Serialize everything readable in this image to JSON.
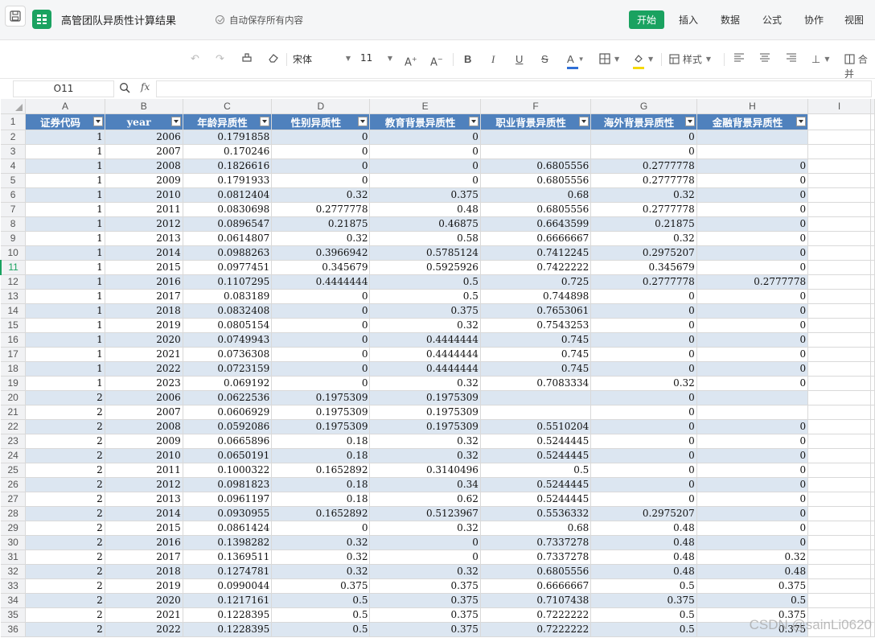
{
  "app": {
    "doc_title": "高管团队异质性计算结果",
    "autosave_text": "自动保存所有内容",
    "menus": [
      "开始",
      "插入",
      "数据",
      "公式",
      "协作",
      "视图"
    ],
    "active_menu": "开始"
  },
  "toolbar": {
    "font_name": "宋体",
    "font_size": "11",
    "style_label": "样式",
    "merge_label": "合并",
    "font_color": "#2f6fd6",
    "fill_color": "#f5d90a"
  },
  "formula_bar": {
    "cell_ref": "O11",
    "fx_label": "fx",
    "formula": ""
  },
  "sheet": {
    "columns": [
      "A",
      "B",
      "C",
      "D",
      "E",
      "F",
      "G",
      "H",
      "I"
    ],
    "headers": [
      "证券代码",
      "year",
      "年龄异质性",
      "性别异质性",
      "教育背景异质性",
      "职业背景异质性",
      "海外背景异质性",
      "金融背景异质性"
    ],
    "header_color": "#4f81bd",
    "band_color": "#dce6f1",
    "active_row": 11,
    "rows": [
      [
        "1",
        "2006",
        "0.1791858",
        "0",
        "0",
        "",
        "0",
        ""
      ],
      [
        "1",
        "2007",
        "0.170246",
        "0",
        "0",
        "",
        "0",
        ""
      ],
      [
        "1",
        "2008",
        "0.1826616",
        "0",
        "0",
        "0.6805556",
        "0.2777778",
        "0"
      ],
      [
        "1",
        "2009",
        "0.1791933",
        "0",
        "0",
        "0.6805556",
        "0.2777778",
        "0"
      ],
      [
        "1",
        "2010",
        "0.0812404",
        "0.32",
        "0.375",
        "0.68",
        "0.32",
        "0"
      ],
      [
        "1",
        "2011",
        "0.0830698",
        "0.2777778",
        "0.48",
        "0.6805556",
        "0.2777778",
        "0"
      ],
      [
        "1",
        "2012",
        "0.0896547",
        "0.21875",
        "0.46875",
        "0.6643599",
        "0.21875",
        "0"
      ],
      [
        "1",
        "2013",
        "0.0614807",
        "0.32",
        "0.58",
        "0.6666667",
        "0.32",
        "0"
      ],
      [
        "1",
        "2014",
        "0.0988263",
        "0.3966942",
        "0.5785124",
        "0.7412245",
        "0.2975207",
        "0"
      ],
      [
        "1",
        "2015",
        "0.0977451",
        "0.345679",
        "0.5925926",
        "0.7422222",
        "0.345679",
        "0"
      ],
      [
        "1",
        "2016",
        "0.1107295",
        "0.4444444",
        "0.5",
        "0.725",
        "0.2777778",
        "0.2777778"
      ],
      [
        "1",
        "2017",
        "0.083189",
        "0",
        "0.5",
        "0.744898",
        "0",
        "0"
      ],
      [
        "1",
        "2018",
        "0.0832408",
        "0",
        "0.375",
        "0.7653061",
        "0",
        "0"
      ],
      [
        "1",
        "2019",
        "0.0805154",
        "0",
        "0.32",
        "0.7543253",
        "0",
        "0"
      ],
      [
        "1",
        "2020",
        "0.0749943",
        "0",
        "0.4444444",
        "0.745",
        "0",
        "0"
      ],
      [
        "1",
        "2021",
        "0.0736308",
        "0",
        "0.4444444",
        "0.745",
        "0",
        "0"
      ],
      [
        "1",
        "2022",
        "0.0723159",
        "0",
        "0.4444444",
        "0.745",
        "0",
        "0"
      ],
      [
        "1",
        "2023",
        "0.069192",
        "0",
        "0.32",
        "0.7083334",
        "0.32",
        "0"
      ],
      [
        "2",
        "2006",
        "0.0622536",
        "0.1975309",
        "0.1975309",
        "",
        "0",
        ""
      ],
      [
        "2",
        "2007",
        "0.0606929",
        "0.1975309",
        "0.1975309",
        "",
        "0",
        ""
      ],
      [
        "2",
        "2008",
        "0.0592086",
        "0.1975309",
        "0.1975309",
        "0.5510204",
        "0",
        "0"
      ],
      [
        "2",
        "2009",
        "0.0665896",
        "0.18",
        "0.32",
        "0.5244445",
        "0",
        "0"
      ],
      [
        "2",
        "2010",
        "0.0650191",
        "0.18",
        "0.32",
        "0.5244445",
        "0",
        "0"
      ],
      [
        "2",
        "2011",
        "0.1000322",
        "0.1652892",
        "0.3140496",
        "0.5",
        "0",
        "0"
      ],
      [
        "2",
        "2012",
        "0.0981823",
        "0.18",
        "0.34",
        "0.5244445",
        "0",
        "0"
      ],
      [
        "2",
        "2013",
        "0.0961197",
        "0.18",
        "0.62",
        "0.5244445",
        "0",
        "0"
      ],
      [
        "2",
        "2014",
        "0.0930955",
        "0.1652892",
        "0.5123967",
        "0.5536332",
        "0.2975207",
        "0"
      ],
      [
        "2",
        "2015",
        "0.0861424",
        "0",
        "0.32",
        "0.68",
        "0.48",
        "0"
      ],
      [
        "2",
        "2016",
        "0.1398282",
        "0.32",
        "0",
        "0.7337278",
        "0.48",
        "0"
      ],
      [
        "2",
        "2017",
        "0.1369511",
        "0.32",
        "0",
        "0.7337278",
        "0.48",
        "0.32"
      ],
      [
        "2",
        "2018",
        "0.1274781",
        "0.32",
        "0.32",
        "0.6805556",
        "0.48",
        "0.48"
      ],
      [
        "2",
        "2019",
        "0.0990044",
        "0.375",
        "0.375",
        "0.6666667",
        "0.5",
        "0.375"
      ],
      [
        "2",
        "2020",
        "0.1217161",
        "0.5",
        "0.375",
        "0.7107438",
        "0.375",
        "0.5"
      ],
      [
        "2",
        "2021",
        "0.1228395",
        "0.5",
        "0.375",
        "0.7222222",
        "0.5",
        "0.375"
      ],
      [
        "2",
        "2022",
        "0.1228395",
        "0.5",
        "0.375",
        "0.7222222",
        "0.5",
        "0.375"
      ]
    ]
  },
  "watermark": "CSDN @sainLi0620"
}
